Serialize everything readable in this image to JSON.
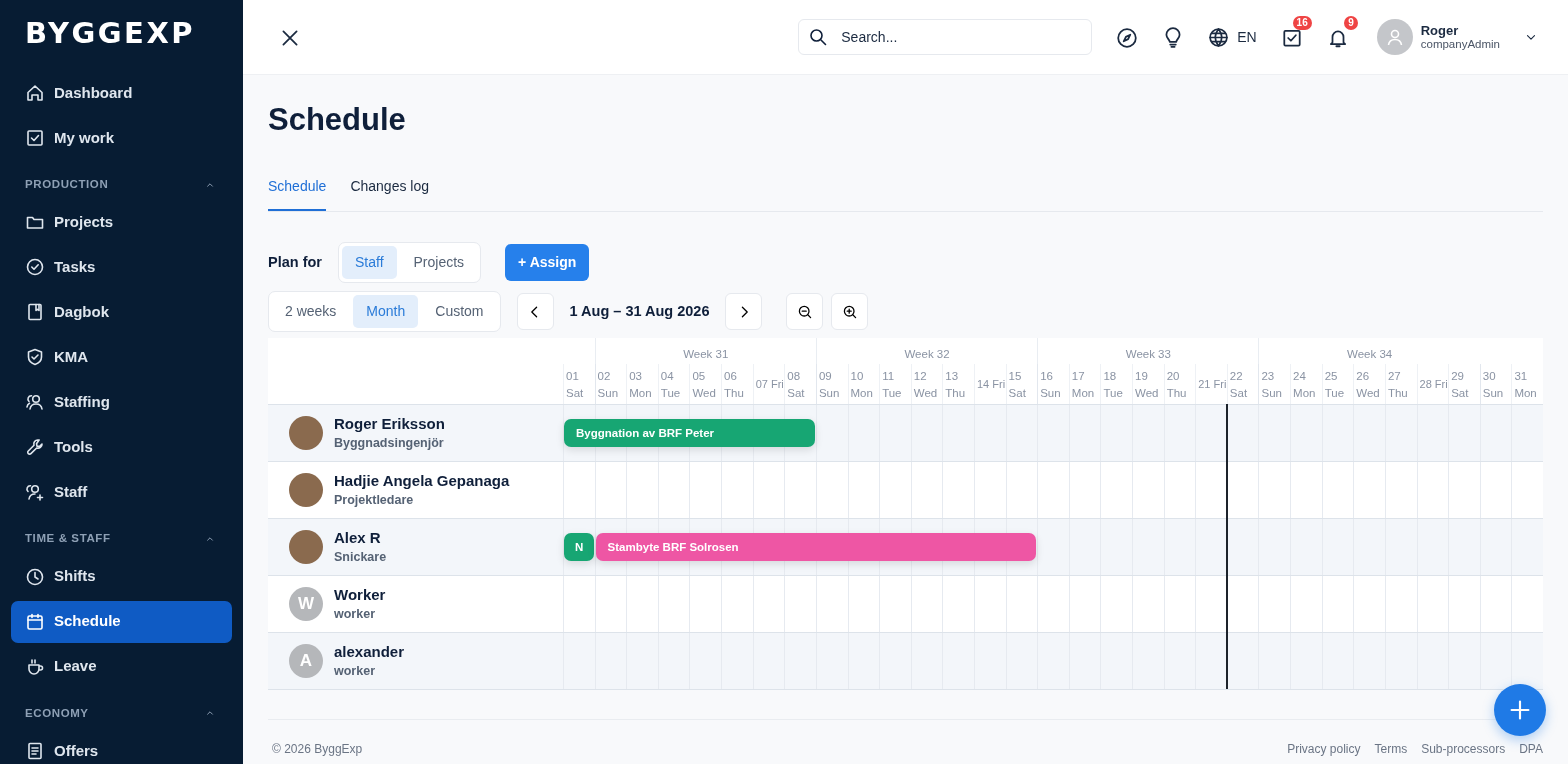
{
  "sidebar": {
    "logo": "BYGGEXP",
    "items": [
      {
        "kind": "link",
        "label": "Dashboard",
        "selected": false
      },
      {
        "kind": "link",
        "label": "My work",
        "selected": false
      },
      {
        "kind": "section",
        "label": "PRODUCTION",
        "expanded": true
      },
      {
        "kind": "link",
        "label": "Projects",
        "selected": false
      },
      {
        "kind": "link",
        "label": "Tasks",
        "selected": false
      },
      {
        "kind": "link",
        "label": "Dagbok",
        "selected": false
      },
      {
        "kind": "link",
        "label": "KMA",
        "selected": false
      },
      {
        "kind": "link",
        "label": "Staffing",
        "selected": false
      },
      {
        "kind": "link",
        "label": "Tools",
        "selected": false
      },
      {
        "kind": "link",
        "label": "Staff",
        "selected": false
      },
      {
        "kind": "section",
        "label": "TIME & STAFF",
        "expanded": true
      },
      {
        "kind": "link",
        "label": "Shifts",
        "selected": false
      },
      {
        "kind": "link",
        "label": "Schedule",
        "selected": true
      },
      {
        "kind": "link",
        "label": "Leave",
        "selected": false
      },
      {
        "kind": "section",
        "label": "ECONOMY",
        "expanded": true
      },
      {
        "kind": "link",
        "label": "Offers",
        "selected": false
      }
    ]
  },
  "header": {
    "search": {
      "placeholder": "Search..."
    },
    "language": "EN",
    "tasks_badge": "16",
    "notifications_badge": "9",
    "user": {
      "name": "Roger",
      "role": "companyAdmin"
    }
  },
  "page": {
    "title": "Schedule",
    "tabs": [
      {
        "label": "Schedule",
        "selected": true
      },
      {
        "label": "Changes log",
        "selected": false
      }
    ],
    "plan_for": {
      "label": "Plan for",
      "options": [
        {
          "label": "Staff",
          "selected": true
        },
        {
          "label": "Projects",
          "selected": false
        }
      ]
    },
    "assign_button": "+ Assign",
    "ranges": [
      {
        "label": "2 weeks",
        "selected": false
      },
      {
        "label": "Month",
        "selected": true
      },
      {
        "label": "Custom",
        "selected": false
      }
    ],
    "period": "1 Aug – 31 Aug 2026"
  },
  "schedule": {
    "weeks": [
      {
        "label": "Week 31"
      },
      {
        "label": "Week 32"
      },
      {
        "label": "Week 33"
      },
      {
        "label": "Week 34"
      }
    ],
    "days": [
      {
        "date": "01",
        "weekday": "Sat",
        "kind": "stacked",
        "week_start": false,
        "today": false
      },
      {
        "date": "02",
        "weekday": "Sun",
        "kind": "stacked",
        "week_start": true,
        "today": false
      },
      {
        "date": "03",
        "weekday": "Mon",
        "kind": "stacked",
        "week_start": false,
        "today": false
      },
      {
        "date": "04",
        "weekday": "Tue",
        "kind": "stacked",
        "week_start": false,
        "today": false
      },
      {
        "date": "05",
        "weekday": "Wed",
        "kind": "stacked",
        "week_start": false,
        "today": false
      },
      {
        "date": "06",
        "weekday": "Thu",
        "kind": "stacked",
        "week_start": false,
        "today": false
      },
      {
        "date": "07",
        "weekday": "Fri",
        "kind": "inline",
        "week_start": false,
        "today": false
      },
      {
        "date": "08",
        "weekday": "Sat",
        "kind": "stacked",
        "week_start": false,
        "today": false
      },
      {
        "date": "09",
        "weekday": "Sun",
        "kind": "stacked",
        "week_start": true,
        "today": false
      },
      {
        "date": "10",
        "weekday": "Mon",
        "kind": "stacked",
        "week_start": false,
        "today": false
      },
      {
        "date": "11",
        "weekday": "Tue",
        "kind": "stacked",
        "week_start": false,
        "today": false
      },
      {
        "date": "12",
        "weekday": "Wed",
        "kind": "stacked",
        "week_start": false,
        "today": false
      },
      {
        "date": "13",
        "weekday": "Thu",
        "kind": "stacked",
        "week_start": false,
        "today": false
      },
      {
        "date": "14",
        "weekday": "Fri",
        "kind": "inline",
        "week_start": false,
        "today": false
      },
      {
        "date": "15",
        "weekday": "Sat",
        "kind": "stacked",
        "week_start": false,
        "today": false
      },
      {
        "date": "16",
        "weekday": "Sun",
        "kind": "stacked",
        "week_start": true,
        "today": false
      },
      {
        "date": "17",
        "weekday": "Mon",
        "kind": "stacked",
        "week_start": false,
        "today": false
      },
      {
        "date": "18",
        "weekday": "Tue",
        "kind": "stacked",
        "week_start": false,
        "today": false
      },
      {
        "date": "19",
        "weekday": "Wed",
        "kind": "stacked",
        "week_start": false,
        "today": false
      },
      {
        "date": "20",
        "weekday": "Thu",
        "kind": "stacked",
        "week_start": false,
        "today": false
      },
      {
        "date": "21",
        "weekday": "Fri",
        "kind": "inline",
        "week_start": false,
        "today": true
      },
      {
        "date": "22",
        "weekday": "Sat",
        "kind": "stacked",
        "week_start": false,
        "today": false
      },
      {
        "date": "23",
        "weekday": "Sun",
        "kind": "stacked",
        "week_start": true,
        "today": false
      },
      {
        "date": "24",
        "weekday": "Mon",
        "kind": "stacked",
        "week_start": false,
        "today": false
      },
      {
        "date": "25",
        "weekday": "Tue",
        "kind": "stacked",
        "week_start": false,
        "today": false
      },
      {
        "date": "26",
        "weekday": "Wed",
        "kind": "stacked",
        "week_start": false,
        "today": false
      },
      {
        "date": "27",
        "weekday": "Thu",
        "kind": "stacked",
        "week_start": false,
        "today": false
      },
      {
        "date": "28",
        "weekday": "Fri",
        "kind": "inline",
        "week_start": false,
        "today": false
      },
      {
        "date": "29",
        "weekday": "Sat",
        "kind": "stacked",
        "week_start": false,
        "today": false
      },
      {
        "date": "30",
        "weekday": "Sun",
        "kind": "stacked",
        "week_start": true,
        "today": false
      },
      {
        "date": "31",
        "weekday": "Mon",
        "kind": "stacked",
        "week_start": false,
        "today": false
      }
    ],
    "people": [
      {
        "name": "Roger Eriksson",
        "role": "Byggnadsingenjör",
        "avatar": {
          "kind": "photo"
        },
        "assignments": [
          {
            "label": "Byggnation av BRF Peter",
            "color": "#17a673"
          }
        ]
      },
      {
        "name": "Hadjie Angela Gepanaga",
        "role": "Projektledare",
        "avatar": {
          "kind": "photo"
        }
      },
      {
        "name": "Alex R",
        "role": "Snickare",
        "avatar": {
          "kind": "photo"
        },
        "assignments": [
          {
            "label": "N",
            "color": "#17a673"
          },
          {
            "label": "Stambyte BRF Solrosen",
            "color": "#ee56a4"
          }
        ]
      },
      {
        "name": "Worker",
        "role": "worker",
        "avatar": {
          "kind": "initial",
          "letter": "W"
        }
      },
      {
        "name": "alexander",
        "role": "worker",
        "avatar": {
          "kind": "initial",
          "letter": "A"
        }
      }
    ]
  },
  "footer": {
    "copyright": "© 2026 ByggExp",
    "links": [
      "Privacy policy",
      "Terms",
      "Sub-processors",
      "DPA"
    ]
  }
}
